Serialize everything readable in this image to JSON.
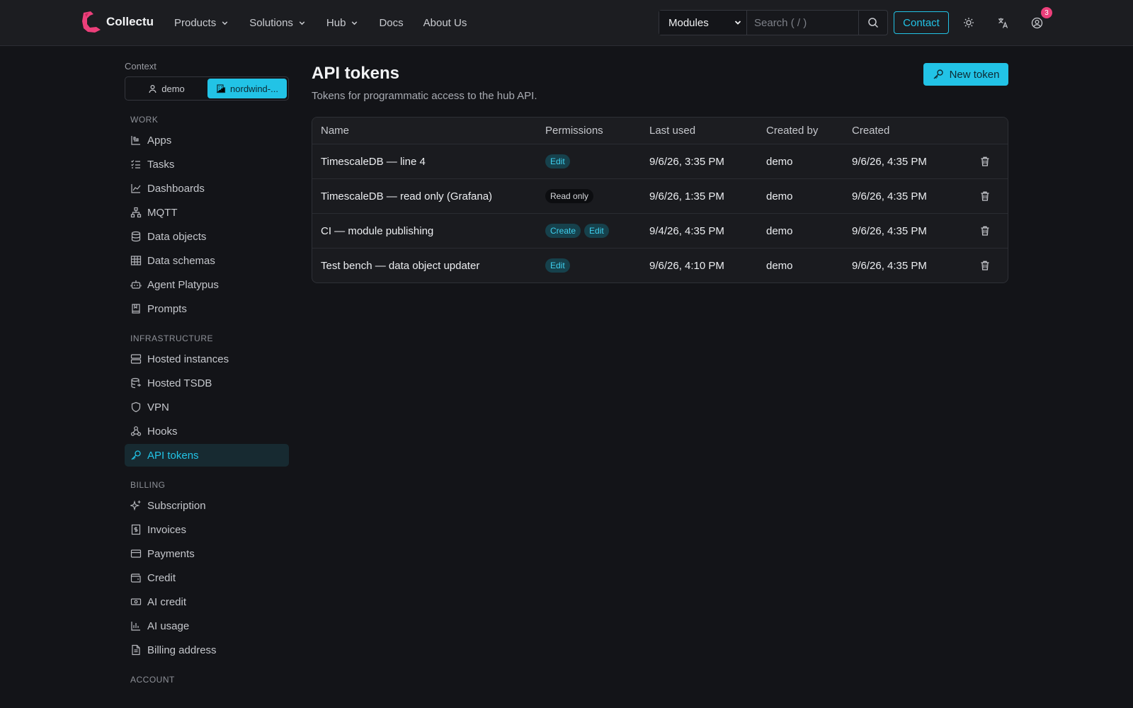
{
  "header": {
    "brand": "Collectu",
    "brand_color": "#ec3f7a",
    "nav": [
      {
        "label": "Products",
        "dropdown": true
      },
      {
        "label": "Solutions",
        "dropdown": true
      },
      {
        "label": "Hub",
        "dropdown": true
      },
      {
        "label": "Docs",
        "dropdown": false
      },
      {
        "label": "About Us",
        "dropdown": false
      }
    ],
    "search": {
      "select_value": "Modules",
      "placeholder": "Search ( / )"
    },
    "contact_label": "Contact",
    "notification_count": "3",
    "accent": "#22c3e6"
  },
  "sidebar": {
    "context_label": "Context",
    "context_options": [
      {
        "label": "demo",
        "icon": "user-icon",
        "active": false
      },
      {
        "label": "nordwind-...",
        "icon": "building-icon",
        "active": true
      }
    ],
    "sections": [
      {
        "title": "WORK",
        "items": [
          {
            "label": "Apps",
            "icon": "apps-icon"
          },
          {
            "label": "Tasks",
            "icon": "tasks-icon"
          },
          {
            "label": "Dashboards",
            "icon": "chart-line-icon"
          },
          {
            "label": "MQTT",
            "icon": "network-icon"
          },
          {
            "label": "Data objects",
            "icon": "database-icon"
          },
          {
            "label": "Data schemas",
            "icon": "table-icon"
          },
          {
            "label": "Agent Platypus",
            "icon": "robot-icon"
          },
          {
            "label": "Prompts",
            "icon": "book-icon"
          }
        ]
      },
      {
        "title": "INFRASTRUCTURE",
        "items": [
          {
            "label": "Hosted instances",
            "icon": "server-icon"
          },
          {
            "label": "Hosted TSDB",
            "icon": "database-icon"
          },
          {
            "label": "VPN",
            "icon": "shield-icon"
          },
          {
            "label": "Hooks",
            "icon": "webhook-icon"
          },
          {
            "label": "API tokens",
            "icon": "key-icon",
            "active": true
          }
        ]
      },
      {
        "title": "BILLING",
        "items": [
          {
            "label": "Subscription",
            "icon": "sparkles-icon"
          },
          {
            "label": "Invoices",
            "icon": "invoice-icon"
          },
          {
            "label": "Payments",
            "icon": "credit-card-icon"
          },
          {
            "label": "Credit",
            "icon": "wallet-icon"
          },
          {
            "label": "AI credit",
            "icon": "ticket-icon"
          },
          {
            "label": "AI usage",
            "icon": "bar-chart-icon"
          },
          {
            "label": "Billing address",
            "icon": "document-icon"
          }
        ]
      },
      {
        "title": "ACCOUNT",
        "items": []
      }
    ]
  },
  "main": {
    "title": "API tokens",
    "subtitle": "Tokens for programmatic access to the hub API.",
    "new_token_label": "New token",
    "table": {
      "columns": [
        "Name",
        "Permissions",
        "Last used",
        "Created by",
        "Created"
      ],
      "rows": [
        {
          "name": "TimescaleDB — line 4",
          "permissions": [
            "Edit"
          ],
          "last_used": "9/6/26, 3:35 PM",
          "created_by": "demo",
          "created": "9/6/26, 4:35 PM"
        },
        {
          "name": "TimescaleDB — read only (Grafana)",
          "permissions": [
            "Read only"
          ],
          "last_used": "9/6/26, 1:35 PM",
          "created_by": "demo",
          "created": "9/6/26, 4:35 PM"
        },
        {
          "name": "CI — module publishing",
          "permissions": [
            "Create",
            "Edit"
          ],
          "last_used": "9/4/26, 4:35 PM",
          "created_by": "demo",
          "created": "9/6/26, 4:35 PM"
        },
        {
          "name": "Test bench — data object updater",
          "permissions": [
            "Edit"
          ],
          "last_used": "9/6/26, 4:10 PM",
          "created_by": "demo",
          "created": "9/6/26, 4:35 PM"
        }
      ]
    }
  }
}
